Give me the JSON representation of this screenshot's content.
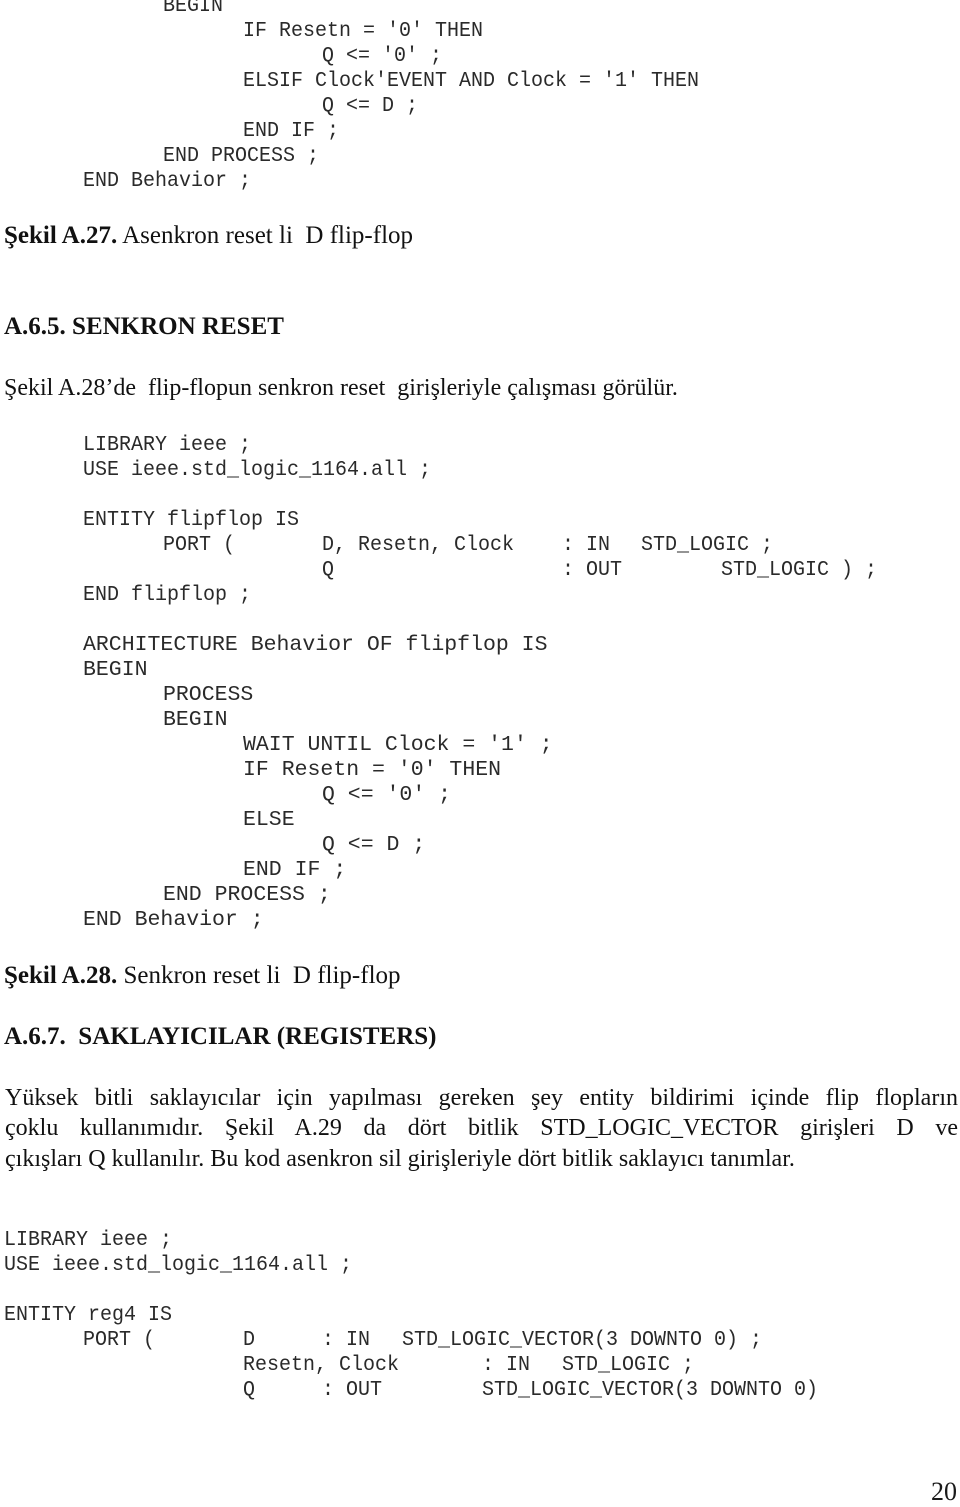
{
  "code_block_1": {
    "lines": [
      "BEGIN",
      "IF Resetn = '0' THEN",
      "Q <= '0' ;",
      "ELSIF Clock'EVENT AND Clock = '1' THEN",
      "Q <= D ;",
      "END IF ;",
      "END PROCESS ;",
      "END Behavior ;"
    ]
  },
  "figure_a27": {
    "label": "Şekil A.27.",
    "caption": " Asenkron reset li  D flip-flop"
  },
  "section_a65": {
    "heading": "A.6.5. SENKRON RESET",
    "intro": "Şekil A.28’de  flip-flopun senkron reset  girişleriyle çalışması görülür."
  },
  "code_block_2": {
    "lines": [
      "LIBRARY ieee ;",
      "USE ieee.std_logic_1164.all ;",
      "ENTITY flipflop IS",
      "PORT (",
      "D, Resetn, Clock",
      ": IN",
      "STD_LOGIC ;",
      "Q",
      ": OUT",
      "STD_LOGIC ) ;",
      "END flipflop ;",
      "ARCHITECTURE Behavior OF flipflop IS",
      "BEGIN",
      "PROCESS",
      "BEGIN",
      "WAIT UNTIL Clock = '1' ;",
      "IF Resetn = '0' THEN",
      "Q <= '0' ;",
      "ELSE",
      "Q <= D ;",
      "END IF ;",
      "END PROCESS ;",
      "END Behavior ;"
    ]
  },
  "figure_a28": {
    "label": "Şekil A.28.",
    "caption": " Senkron reset li  D flip-flop"
  },
  "section_a67": {
    "heading": "A.6.7.  SAKLAYICILAR (REGISTERS)",
    "paragraph_lines": [
      "Yüksek bitli saklayıcılar için yapılması gereken şey entity bildirimi içinde flip flopların",
      "çoklu kullanımıdır. Şekil A.29 da dört bitlik STD_LOGIC_VECTOR girişleri D ve",
      "çıkışları Q kullanılır. Bu kod asenkron sil girişleriyle dört bitlik saklayıcı tanımlar."
    ]
  },
  "code_block_3": {
    "lines": [
      "LIBRARY ieee ;",
      "USE ieee.std_logic_1164.all ;",
      "ENTITY reg4 IS",
      "PORT (",
      "D",
      ": IN",
      "STD_LOGIC_VECTOR(3 DOWNTO 0) ;",
      "Resetn, Clock",
      ": IN",
      "STD_LOGIC ;",
      "Q",
      ": OUT",
      "STD_LOGIC_VECTOR(3 DOWNTO 0)"
    ]
  },
  "page_number": "20"
}
